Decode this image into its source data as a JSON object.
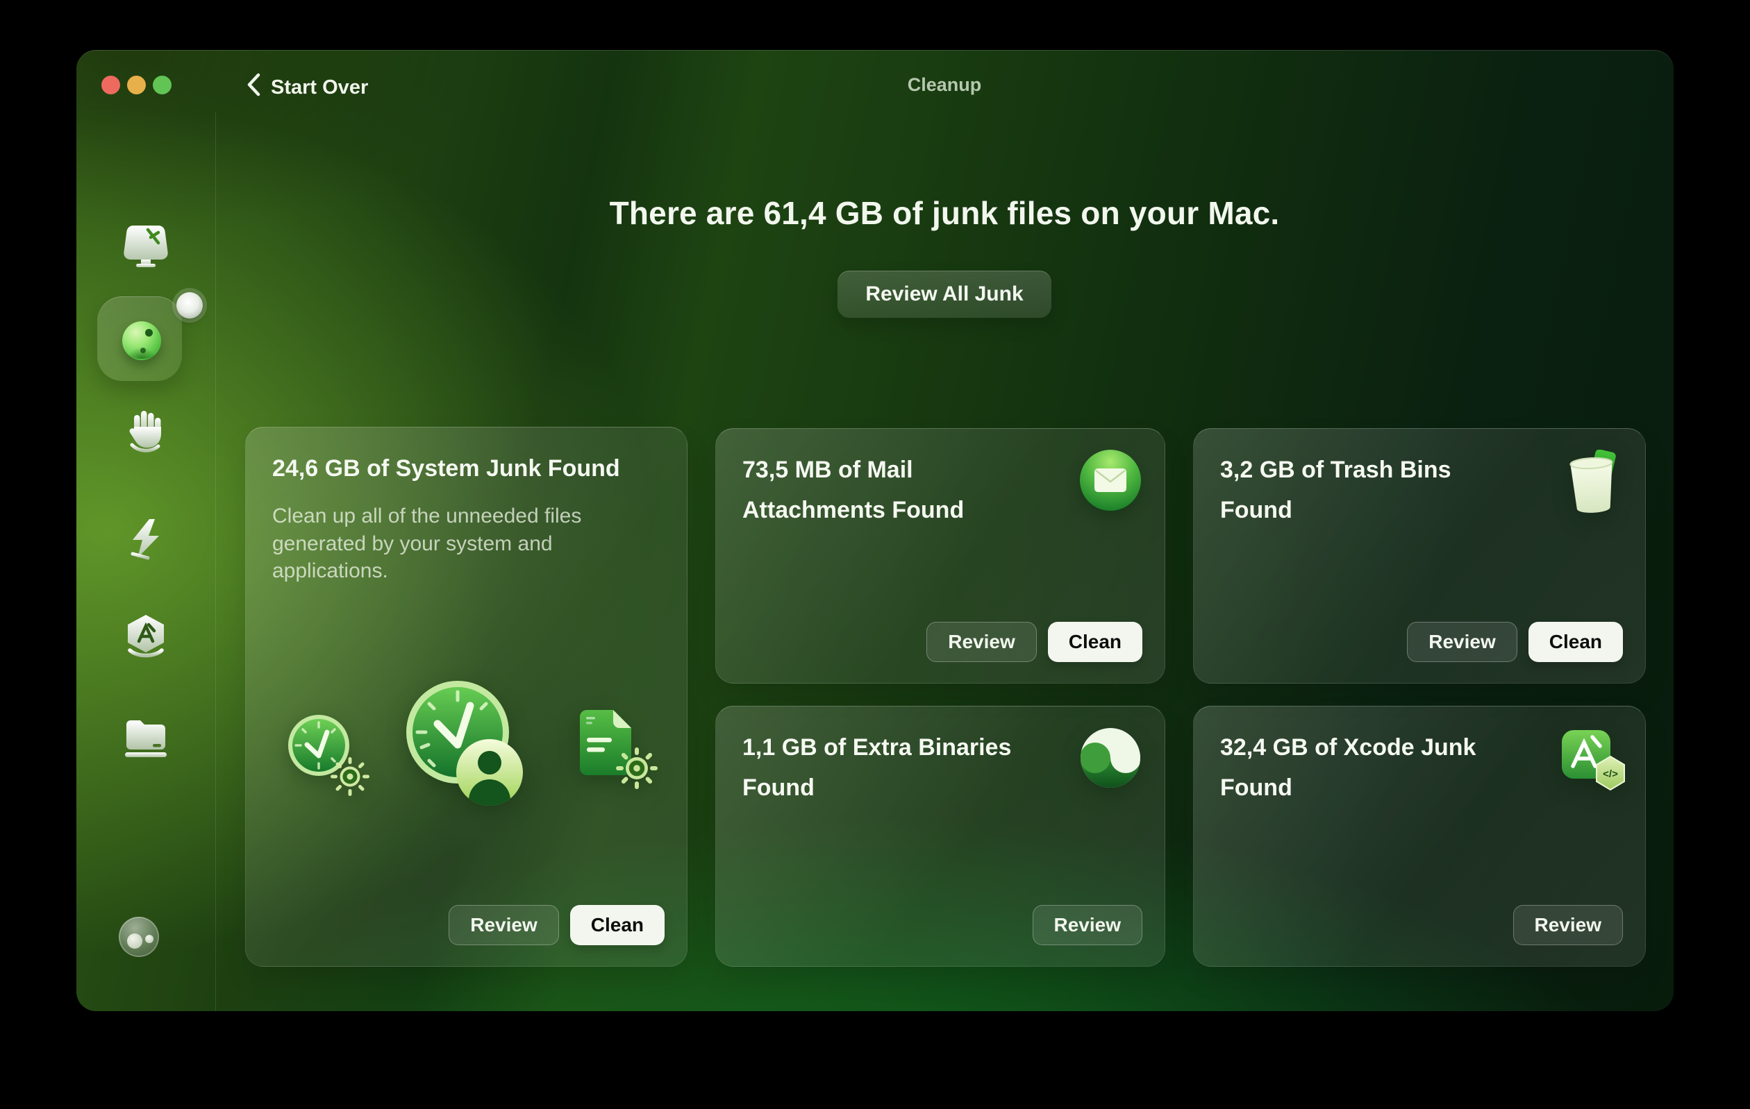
{
  "titlebar": {
    "back_label": "Start Over",
    "window_title": "Cleanup"
  },
  "hero": {
    "headline": "There are 61,4 GB of junk files on your Mac.",
    "review_all_label": "Review All Junk"
  },
  "sidebar": {
    "icons": [
      {
        "name": "smart-care-icon"
      },
      {
        "name": "cleanup-orb-icon",
        "selected": true,
        "badge": "notification-dot"
      },
      {
        "name": "protection-hand-icon"
      },
      {
        "name": "performance-lightning-icon"
      },
      {
        "name": "applications-icon"
      },
      {
        "name": "files-folder-icon"
      }
    ],
    "assistant_icon": "assistant-avatar"
  },
  "cards": {
    "system_junk": {
      "title": "24,6 GB of System Junk Found",
      "description": "Clean up all of the unneeded files generated by your system and applications.",
      "review_label": "Review",
      "clean_label": "Clean",
      "icons": [
        "clock-gear-icon",
        "clock-user-icon",
        "document-gear-icon"
      ]
    },
    "mail": {
      "title": "73,5 MB of Mail Attachments Found",
      "review_label": "Review",
      "clean_label": "Clean",
      "icon": "mail-icon"
    },
    "trash": {
      "title": "3,2 GB of Trash Bins Found",
      "review_label": "Review",
      "clean_label": "Clean",
      "icon": "trash-bin-icon"
    },
    "binaries": {
      "title": "1,1 GB of Extra Binaries Found",
      "review_label": "Review",
      "icon": "binaries-icon"
    },
    "xcode": {
      "title": "32,4 GB of Xcode Junk Found",
      "review_label": "Review",
      "icon": "xcode-icon"
    }
  },
  "colors": {
    "accent_green": "#2e8f33",
    "clean_button_bg": "#f3f6ef",
    "traffic_red": "#ee6a5f",
    "traffic_yellow": "#e8b04a",
    "traffic_green": "#62c454"
  }
}
